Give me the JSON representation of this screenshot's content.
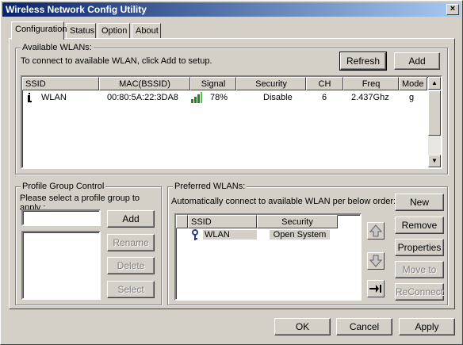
{
  "window": {
    "title": "Wireless Network Config Utility",
    "close": "×"
  },
  "tabs": [
    {
      "label": "Configuration"
    },
    {
      "label": "Status"
    },
    {
      "label": "Option"
    },
    {
      "label": "About"
    }
  ],
  "available": {
    "group_title": "Available WLANs:",
    "hint": "To connect to available WLAN, click Add to setup.",
    "refresh_label": "Refresh",
    "add_label": "Add",
    "columns": [
      "SSID",
      "MAC(BSSID)",
      "Signal",
      "Security",
      "CH",
      "Freq",
      "Mode"
    ],
    "rows": [
      {
        "ssid": "WLAN",
        "mac": "00:80:5A:22:3DA8",
        "signal": "78%",
        "security": "Disable",
        "ch": "6",
        "freq": "2.437Ghz",
        "mode": "g"
      }
    ]
  },
  "profile": {
    "group_title": "Profile Group Control",
    "hint": "Please select a profile group to apply :",
    "input_value": "",
    "add_label": "Add",
    "rename_label": "Rename",
    "delete_label": "Delete",
    "select_label": "Select"
  },
  "preferred": {
    "group_title": "Preferred WLANs:",
    "hint": "Automatically connect to available WLAN per below order:",
    "columns": [
      "SSID",
      "Security"
    ],
    "rows": [
      {
        "ssid": "WLAN",
        "security": "Open System"
      }
    ],
    "new_label": "New",
    "remove_label": "Remove",
    "properties_label": "Properties",
    "moveto_label": "Move to",
    "reconnect_label": "ReConnect"
  },
  "footer": {
    "ok_label": "OK",
    "cancel_label": "Cancel",
    "apply_label": "Apply"
  }
}
